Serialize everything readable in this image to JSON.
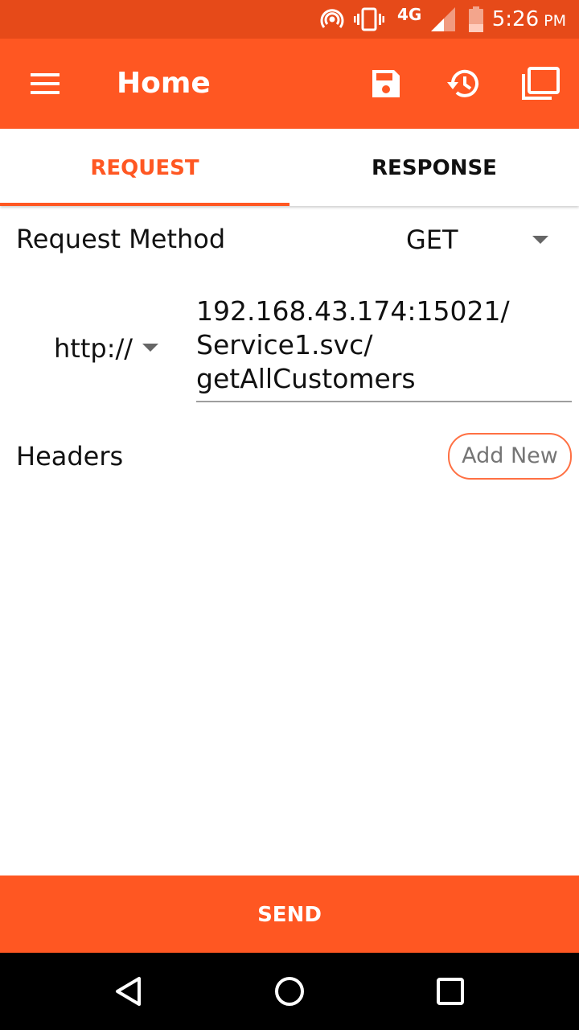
{
  "status_bar": {
    "network_label": "4G",
    "time": "5:26",
    "ampm": "PM",
    "icons": [
      "hotspot-icon",
      "vibrate-icon",
      "signal-icon",
      "battery-icon"
    ]
  },
  "app_bar": {
    "title": "Home",
    "icons": [
      "menu-icon",
      "save-icon",
      "history-icon",
      "collections-icon"
    ]
  },
  "tabs": [
    {
      "label": "REQUEST",
      "selected": true
    },
    {
      "label": "RESPONSE",
      "selected": false
    }
  ],
  "request": {
    "method_label": "Request Method",
    "method_value": "GET",
    "protocol_value": "http://",
    "url_lines": [
      "192.168.43.174:15021/",
      "Service1.svc/",
      "getAllCustomers"
    ],
    "headers_label": "Headers",
    "add_new_label": "Add New"
  },
  "send_label": "SEND",
  "nav_bar": {
    "icons": [
      "back-icon",
      "home-icon",
      "recents-icon"
    ]
  },
  "colors": {
    "primary": "#ff5722",
    "primary_dark": "#e64a19",
    "text": "#111111",
    "hint": "#757575"
  }
}
